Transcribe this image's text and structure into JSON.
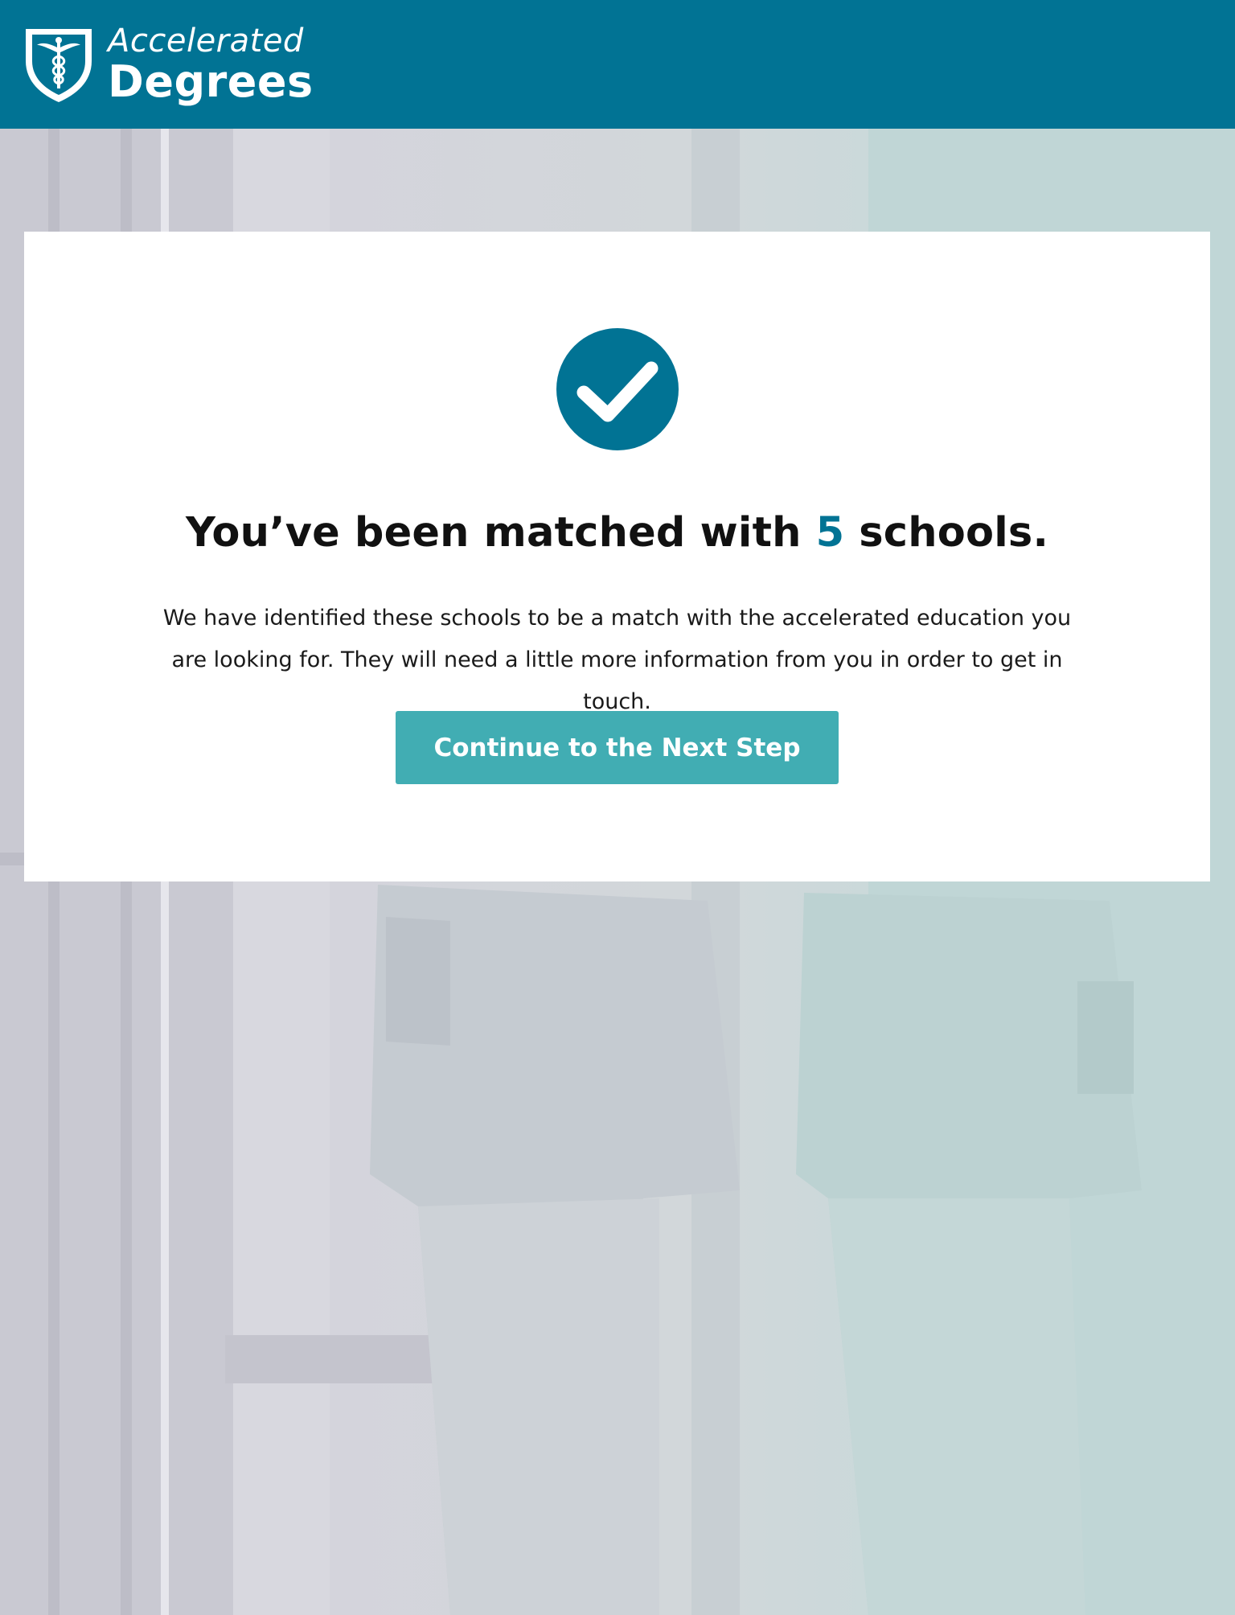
{
  "brand": {
    "line1": "Accelerated",
    "line2": "Degrees",
    "logo_icon": "caduceus-shield-icon",
    "color": "#017394"
  },
  "result": {
    "status_icon": "check-circle-icon",
    "headline_prefix": "You’ve been matched with ",
    "match_count": "5",
    "headline_suffix": " schools.",
    "description": "We have identified these schools to be a match with the accelerated education you are looking for. They will need a little more information from you in order to get in touch."
  },
  "cta": {
    "label": "Continue to the Next Step",
    "color": "#41adb3"
  }
}
